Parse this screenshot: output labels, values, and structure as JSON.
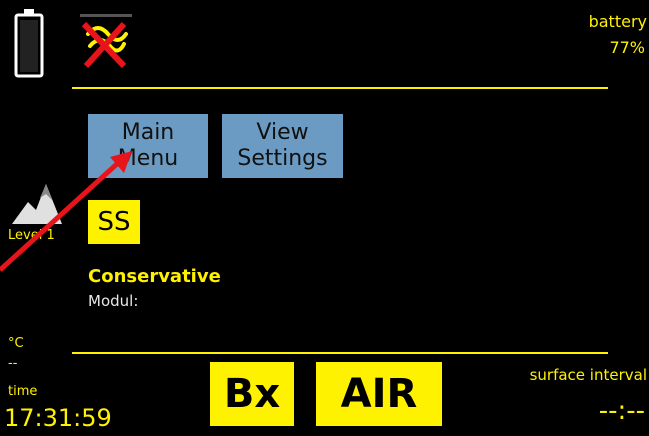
{
  "battery": {
    "label": "battery",
    "value": "77%",
    "fill_fraction": 0
  },
  "icons": {
    "battery": "battery-empty-icon",
    "status": "no-signal-icon",
    "altitude": "mountain-icon",
    "pointer": "red-arrow"
  },
  "buttons": {
    "main_menu_line1": "Main",
    "main_menu_line2": "Menu",
    "view_settings_line1": "View",
    "view_settings_line2": "Settings"
  },
  "altitude": {
    "level": "Level 1"
  },
  "ss_badge": "SS",
  "conservatism": {
    "title": "Conservative",
    "modul_label": "Modul:"
  },
  "temperature": {
    "unit": "°C",
    "value": "--"
  },
  "time": {
    "label": "time",
    "value": "17:31:59"
  },
  "gas": {
    "bx": "Bx",
    "mix": "AIR"
  },
  "surface_interval": {
    "label": "surface interval",
    "value": "--:--"
  },
  "colors": {
    "accent": "#FFF200",
    "button": "#6B9BC3",
    "background": "#000000",
    "arrow": "#E8141B"
  }
}
